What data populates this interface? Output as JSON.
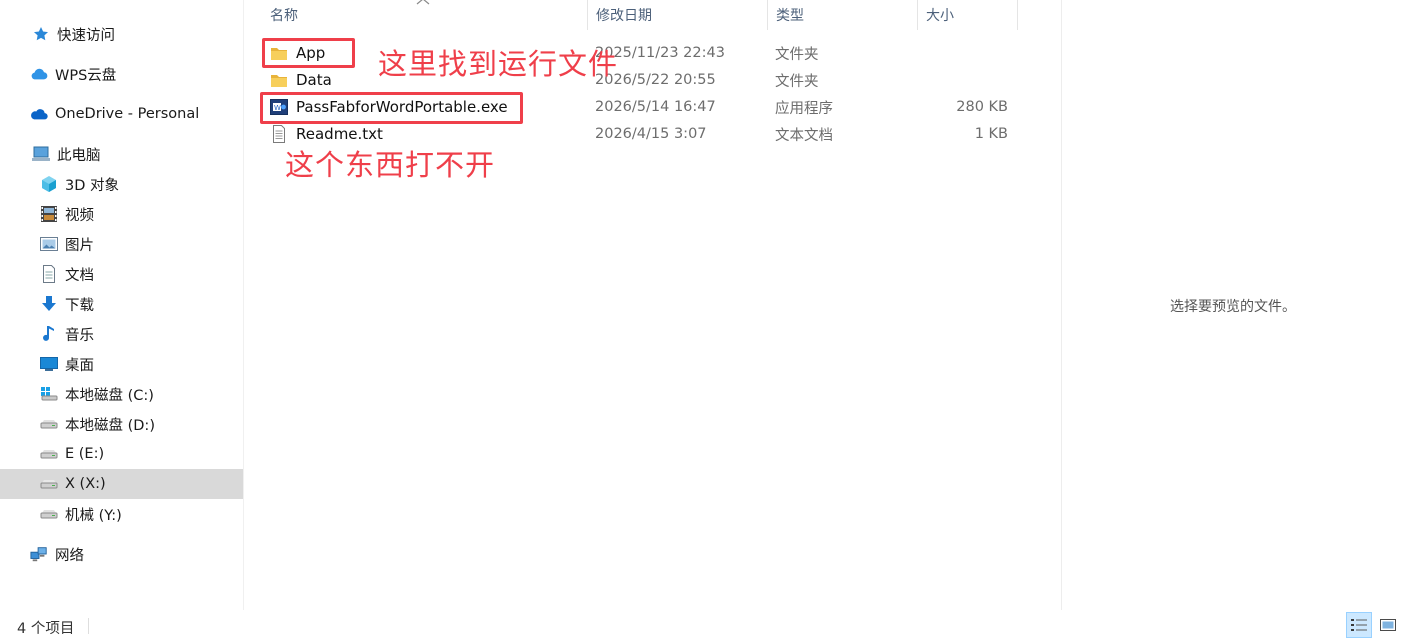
{
  "sidebar": {
    "items": [
      {
        "label": "快速访问",
        "icon": "star-icon"
      },
      {
        "label": "WPS云盘",
        "icon": "cloud-icon"
      },
      {
        "label": "OneDrive - Personal",
        "icon": "onedrive-icon"
      },
      {
        "label": "此电脑",
        "icon": "computer-icon"
      },
      {
        "label": "3D 对象",
        "icon": "cube-icon"
      },
      {
        "label": "视频",
        "icon": "film-icon"
      },
      {
        "label": "图片",
        "icon": "picture-icon"
      },
      {
        "label": "文档",
        "icon": "document-icon"
      },
      {
        "label": "下载",
        "icon": "download-arrow-icon"
      },
      {
        "label": "音乐",
        "icon": "music-note-icon"
      },
      {
        "label": "桌面",
        "icon": "desktop-icon"
      },
      {
        "label": "本地磁盘 (C:)",
        "icon": "windows-drive-icon"
      },
      {
        "label": "本地磁盘 (D:)",
        "icon": "drive-icon"
      },
      {
        "label": "E (E:)",
        "icon": "drive-icon"
      },
      {
        "label": "X (X:)",
        "icon": "drive-icon",
        "selected": true
      },
      {
        "label": "机械 (Y:)",
        "icon": "drive-icon"
      },
      {
        "label": "网络",
        "icon": "network-icon"
      }
    ]
  },
  "columns": {
    "name": "名称",
    "date": "修改日期",
    "type": "类型",
    "size": "大小"
  },
  "files": [
    {
      "name": "App",
      "date": "2025/11/23 22:43",
      "type": "文件夹",
      "size": "",
      "icon": "folder-icon"
    },
    {
      "name": "Data",
      "date": "2026/5/22 20:55",
      "type": "文件夹",
      "size": "",
      "icon": "folder-icon"
    },
    {
      "name": "PassFabforWordPortable.exe",
      "date": "2026/5/14 16:47",
      "type": "应用程序",
      "size": "280 KB",
      "icon": "exe-app-icon"
    },
    {
      "name": "Readme.txt",
      "date": "2026/4/15 3:07",
      "type": "文本文档",
      "size": "1 KB",
      "icon": "text-file-icon"
    }
  ],
  "annotations": {
    "app_note": "这里找到运行文件",
    "exe_note": "这个东西打不开",
    "color": "#ef3f4a"
  },
  "preview": {
    "empty_text": "选择要预览的文件。"
  },
  "status": {
    "item_count": "4 个项目"
  },
  "colors": {
    "selected_bg": "#d9d9d9",
    "folder": "#f5c443",
    "accent_blue": "#0078d4"
  }
}
